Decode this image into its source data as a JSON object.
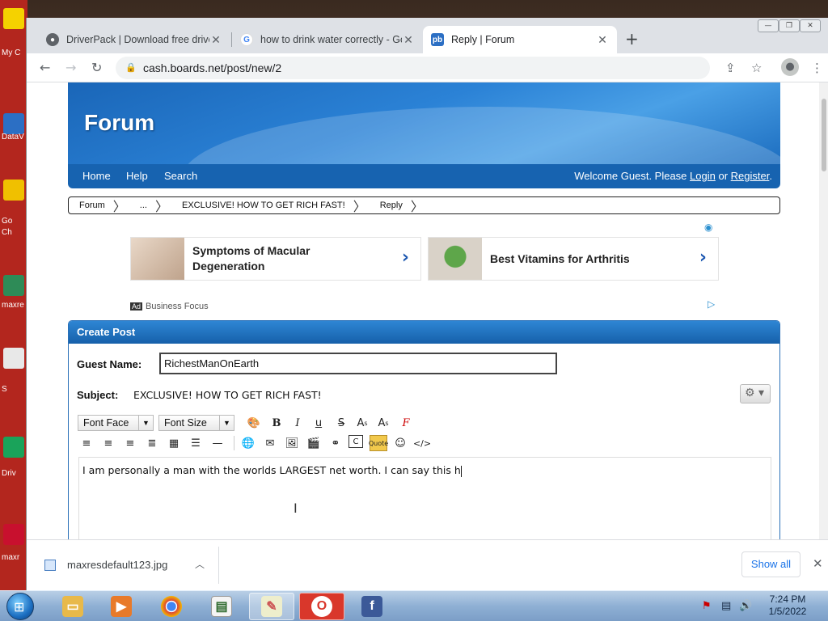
{
  "desktop": {
    "labels": [
      "My C",
      "DataV",
      "Go",
      "Ch",
      "maxre",
      "S",
      "Driv",
      "maxr"
    ]
  },
  "browser": {
    "tabs": [
      {
        "title": "DriverPack | Download free drive",
        "favicon": "globe-icon"
      },
      {
        "title": "how to drink water correctly - Go",
        "favicon": "google-icon"
      },
      {
        "title": "Reply | Forum",
        "favicon": "proboards-icon"
      }
    ],
    "url": "cash.boards.net/post/new/2"
  },
  "forum": {
    "title": "Forum",
    "nav": [
      "Home",
      "Help",
      "Search"
    ],
    "welcome_prefix": "Welcome Guest. Please",
    "login": "Login",
    "or": "or",
    "register": "Register",
    "welcome_suffix": ".",
    "breadcrumb": [
      "Forum",
      "...",
      "EXCLUSIVE! HOW TO GET RICH FAST!",
      "Reply"
    ]
  },
  "ads": {
    "items": [
      "Symptoms of Macular Degeneration",
      "Best Vitamins for Arthritis"
    ],
    "badge": "Ad",
    "source": "Business Focus"
  },
  "post": {
    "header": "Create Post",
    "guest_name_label": "Guest Name:",
    "guest_name_value": "RichestManOnEarth",
    "subject_label": "Subject:",
    "subject_value": "EXCLUSIVE! HOW TO GET RICH FAST!",
    "font_face": "Font Face",
    "font_size": "Font Size",
    "body": "I am personally a man with the worlds LARGEST net worth. I can say this h"
  },
  "downloads": {
    "file": "maxresdefault123.jpg",
    "show_all": "Show all"
  },
  "taskbar": {
    "time": "7:24 PM",
    "date": "1/5/2022"
  },
  "colors": {
    "forum_blue": "#1763b0",
    "chrome_tabbar": "#dee1e6",
    "link_blue": "#1a73e8"
  }
}
